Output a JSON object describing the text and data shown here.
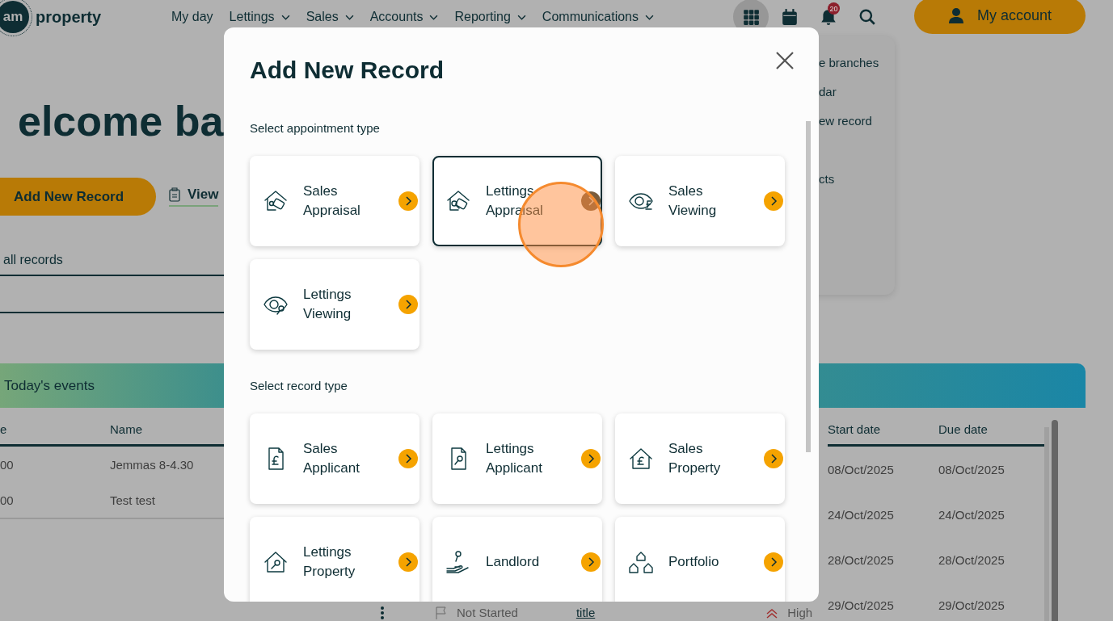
{
  "header": {
    "logo": {
      "mark": "am",
      "name": "property"
    },
    "menu": [
      {
        "label": "My day",
        "dropdown": false
      },
      {
        "label": "Lettings",
        "dropdown": true
      },
      {
        "label": "Sales",
        "dropdown": true
      },
      {
        "label": "Accounts",
        "dropdown": true
      },
      {
        "label": "Reporting",
        "dropdown": true
      },
      {
        "label": "Communications",
        "dropdown": true
      }
    ],
    "tools": [
      {
        "kind": "apps",
        "selected": true
      },
      {
        "kind": "calendar",
        "selected": false
      },
      {
        "kind": "notifications",
        "selected": false,
        "badge": "20"
      },
      {
        "kind": "search",
        "selected": false
      }
    ],
    "account_button": "My account"
  },
  "dashboard": {
    "heading": "elcome ba",
    "add_button": "Add New Record",
    "view_link": "View",
    "records_select": "all records",
    "menu_panel": [
      "e branches",
      "dar",
      "ew record",
      "cts"
    ],
    "events": {
      "title": "Today's events",
      "columns": [
        "e",
        "Name"
      ],
      "rows": [
        [
          "00",
          "Jemmas 8-4.30"
        ],
        [
          "00",
          "Test test"
        ]
      ]
    },
    "tasks": {
      "columns": [
        "Start date",
        "Due date"
      ],
      "rows": [
        [
          "08/Oct/2025",
          "08/Oct/2025"
        ],
        [
          "24/Oct/2025",
          "24/Oct/2025"
        ],
        [
          "28/Oct/2025",
          "28/Oct/2025"
        ],
        [
          "29/Oct/2025",
          "29/Oct/2025"
        ]
      ],
      "last_row": {
        "status": "Not Started",
        "title": "title",
        "priority": "High"
      }
    }
  },
  "modal": {
    "title": "Add New Record",
    "sections": [
      {
        "heading": "Select appointment type",
        "cards": [
          {
            "label": "Sales Appraisal",
            "selected": false
          },
          {
            "label": "Lettings Appraisal",
            "selected": true
          },
          {
            "label": "Sales Viewing",
            "selected": false
          },
          {
            "label": "Lettings Viewing",
            "selected": false
          }
        ]
      },
      {
        "heading": "Select record type",
        "cards": [
          {
            "label": "Sales Applicant",
            "selected": false
          },
          {
            "label": "Lettings Applicant",
            "selected": false
          },
          {
            "label": "Sales Property",
            "selected": false
          },
          {
            "label": "Lettings Property",
            "selected": false
          },
          {
            "label": "Landlord",
            "selected": false
          },
          {
            "label": "Portfolio",
            "selected": false
          }
        ]
      }
    ]
  }
}
